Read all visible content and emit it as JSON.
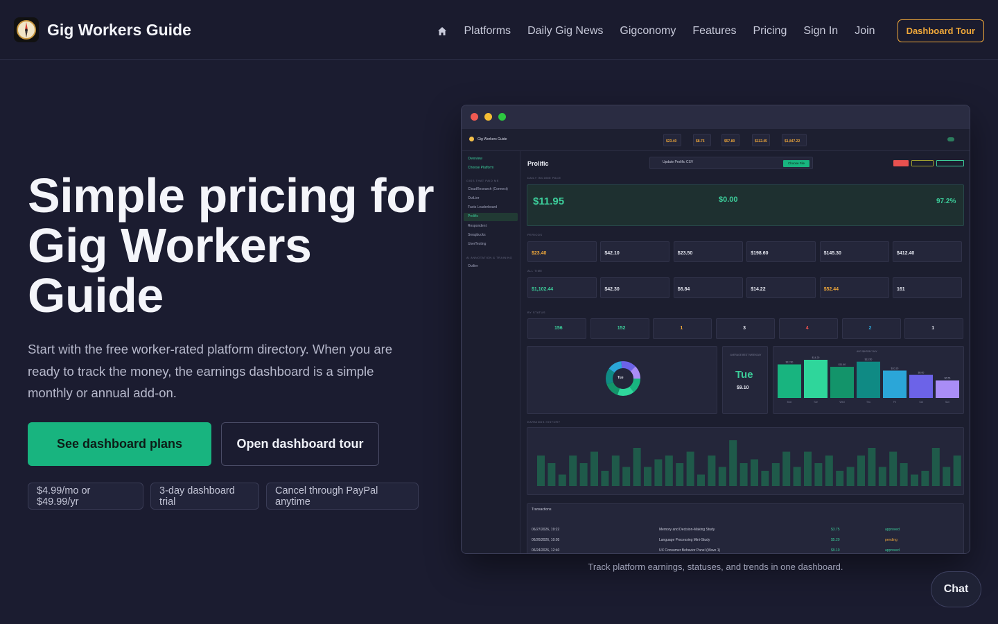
{
  "nav": {
    "brand": "Gig Workers Guide",
    "links": [
      "Platforms",
      "Daily Gig News",
      "Gigconomy",
      "Features",
      "Pricing",
      "Sign In",
      "Join"
    ],
    "cta": "Dashboard Tour",
    "home_icon": "home-icon",
    "logo_icon": "compass-icon"
  },
  "hero": {
    "title": "Simple pricing for Gig Workers Guide",
    "subtitle": "Start with the free worker-rated platform directory. When you are ready to track the money, the earnings dashboard is a simple monthly or annual add-on.",
    "primary_button": "See dashboard plans",
    "secondary_button": "Open dashboard tour",
    "pills": [
      "$4.99/mo or $49.99/yr",
      "3-day dashboard trial",
      "Cancel through PayPal anytime"
    ]
  },
  "screenshot": {
    "caption": "Track platform earnings, statuses, and trends in one dashboard.",
    "app_name": "Gig Workers Guide",
    "platform": "Prolific",
    "upload_label": "Update Prolific CSV",
    "choose_file": "Choose File",
    "top_stats": [
      "$23.40",
      "$8.75",
      "$57.80",
      "$112.45",
      "$1,847.22"
    ],
    "side_items": [
      "Overview",
      "Choose Platform",
      "CloudResearch (Connect)",
      "OutLier",
      "Facts Leaderboard",
      "Prolific",
      "Respondent",
      "Swagbucks",
      "UserTesting",
      "Outlier"
    ],
    "today_earned": "$11.95",
    "today_pending": "$0.00",
    "approval_rate": "97.2%",
    "period_values": [
      "$23.40",
      "$42.10",
      "$23.50",
      "$198.60",
      "$145.30",
      "$412.40"
    ],
    "alltime_values": [
      "$1,102.44",
      "$42.30",
      "$6.84",
      "$14.22",
      "$52.44",
      "161"
    ],
    "status_values": [
      "156",
      "152",
      "1",
      "3",
      "4",
      "2",
      "1"
    ],
    "donut_center": "Tue",
    "best_weekday_label": "AVERAGE BEST WEEKDAY",
    "best_weekday": "Tue",
    "best_weekday_value": "$9.10",
    "avg_by_day_title": "AVG $/HR BY DAY",
    "avg_by_day": [
      12.5,
      14.2,
      11.6,
      13.5,
      10.2,
      8.6,
      6.55
    ],
    "avg_by_day_labels": [
      "$12.50",
      "$14.20",
      "$11.60",
      "$13.50",
      "$10.20",
      "$8.60",
      "$6.55"
    ],
    "avg_by_day_days": [
      "Mon",
      "Tue",
      "Wed",
      "Thu",
      "Fri",
      "Sat",
      "Sun"
    ],
    "history": [
      8,
      6,
      3,
      8,
      6,
      9,
      4,
      8,
      5,
      10,
      5,
      7,
      8,
      6,
      9,
      3,
      8,
      5,
      12,
      6,
      7,
      4,
      6,
      9,
      5,
      9,
      6,
      8,
      4,
      5,
      8,
      10,
      5,
      9,
      6,
      3,
      4,
      10,
      5,
      8
    ],
    "transactions": [
      {
        "date": "06/27/2026, 19:22",
        "study": "Memory and Decision-Making Study",
        "amount": "$3.75",
        "status": "approved"
      },
      {
        "date": "06/26/2026, 10:05",
        "study": "Language Processing Mini-Study",
        "amount": "$5.20",
        "status": "pending"
      },
      {
        "date": "06/24/2026, 12:40",
        "study": "UX Consumer Behavior Panel (Wave 1)",
        "amount": "$9.10",
        "status": "approved"
      }
    ],
    "colors": {
      "green": "#18b47f",
      "amber": "#f0a83a",
      "red": "#e8514f",
      "blue": "#2ba6d8",
      "purple": "#8a7cf0"
    }
  },
  "chat": {
    "label": "Chat"
  }
}
